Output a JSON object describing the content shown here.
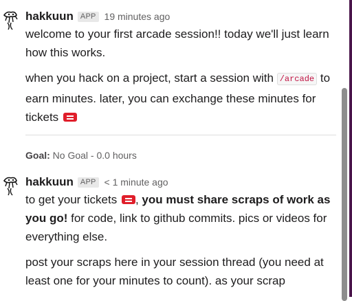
{
  "messages": [
    {
      "username": "hakkuun",
      "badge": "APP",
      "timestamp": "19 minutes ago",
      "p1": "welcome to your first arcade session!! today we'll just learn how this works.",
      "p2_before": "when you hack on a project, start a session with",
      "p2_code": "/arcade",
      "p2_after": "to earn minutes. later, you can exchange these minutes for tickets"
    },
    {
      "username": "hakkuun",
      "badge": "APP",
      "timestamp": "< 1 minute ago",
      "p1_before": "to get your tickets",
      "p1_bold": "you must share scraps of work as you go!",
      "p1_after": "for code, link to github commits. pics or videos for everything else.",
      "p2": "post your scraps here in your session thread (you need at least one for your minutes to count). as your scrap"
    }
  ],
  "goal": {
    "label": "Goal:",
    "value": "No Goal - 0.0 hours"
  },
  "icons": {
    "avatar": "hakkuun-avatar-icon",
    "ticket": "ticket-icon"
  },
  "colors": {
    "ticket": "#e01e2a",
    "code_text": "#c01343",
    "sidebar_accent": "#4a154b"
  }
}
